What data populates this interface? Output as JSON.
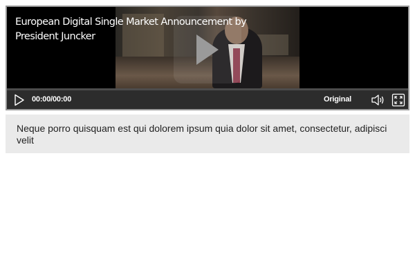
{
  "video": {
    "title": "European Digital Single Market Announcement by President Juncker",
    "time": "00:00/00:00",
    "quality": "Original"
  },
  "caption": {
    "text": "Neque porro quisquam est qui dolorem ipsum quia dolor sit amet, consectetur, adipisci velit"
  },
  "icons": {
    "overlay_play": "play-icon",
    "control_play": "play-outline-icon",
    "volume": "speaker-icon",
    "fullscreen": "expand-icon"
  },
  "colors": {
    "controls_bar": "#2c2c2c",
    "caption_background": "#eaeaea",
    "text_light": "#ffffff",
    "text_dark": "#222222"
  }
}
